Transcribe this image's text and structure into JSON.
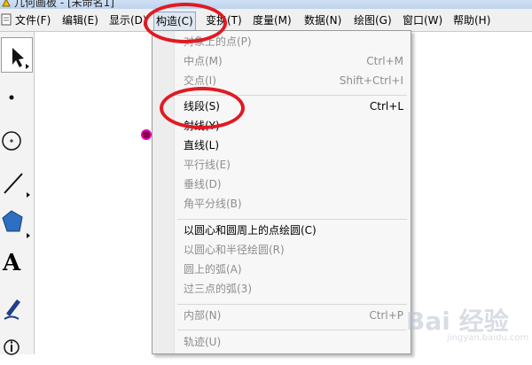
{
  "window": {
    "title": "几何画板 - [未命名1]"
  },
  "menubar": {
    "items": [
      "文件(F)",
      "编辑(E)",
      "显示(D)",
      "构造(C)",
      "变换(T)",
      "度量(M)",
      "数据(N)",
      "绘图(G)",
      "窗口(W)",
      "帮助(H)"
    ],
    "active": "构造(C)"
  },
  "toolbar": {
    "tools": [
      "arrow-select-tool",
      "point-tool",
      "compass-tool",
      "straightedge-tool",
      "polygon-tool",
      "text-tool",
      "marker-tool",
      "information-tool"
    ],
    "text_tool_glyph": "A"
  },
  "construct_menu": {
    "items": [
      {
        "label": "对象上的点(P)",
        "shortcut": "",
        "enabled": false
      },
      {
        "label": "中点(M)",
        "shortcut": "Ctrl+M",
        "enabled": false
      },
      {
        "label": "交点(I)",
        "shortcut": "Shift+Ctrl+I",
        "enabled": false
      },
      {
        "label": "线段(S)",
        "shortcut": "Ctrl+L",
        "enabled": true
      },
      {
        "label": "射线(Y)",
        "shortcut": "",
        "enabled": true
      },
      {
        "label": "直线(L)",
        "shortcut": "",
        "enabled": true
      },
      {
        "label": "平行线(E)",
        "shortcut": "",
        "enabled": false
      },
      {
        "label": "垂线(D)",
        "shortcut": "",
        "enabled": false
      },
      {
        "label": "角平分线(B)",
        "shortcut": "",
        "enabled": false
      },
      {
        "label": "以圆心和圆周上的点绘圆(C)",
        "shortcut": "",
        "enabled": true
      },
      {
        "label": "以圆心和半径绘圆(R)",
        "shortcut": "",
        "enabled": false
      },
      {
        "label": "圆上的弧(A)",
        "shortcut": "",
        "enabled": false
      },
      {
        "label": "过三点的弧(3)",
        "shortcut": "",
        "enabled": false
      },
      {
        "label": "内部(N)",
        "shortcut": "Ctrl+P",
        "enabled": false
      },
      {
        "label": "轨迹(U)",
        "shortcut": "",
        "enabled": false
      }
    ]
  },
  "colors": {
    "annotation_red": "#e01a22",
    "point_fill": "#8a004a",
    "point_ring": "#e000b0",
    "disabled_text": "#8d8d8d"
  },
  "watermark": {
    "text": "Bai 经验",
    "sub": "jingyan.baidu.com"
  }
}
